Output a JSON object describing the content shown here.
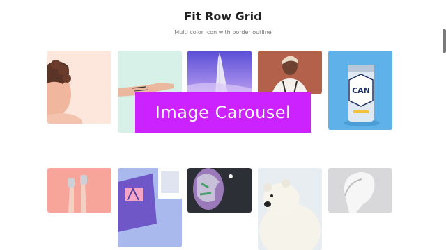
{
  "page": {
    "title": "Fit Row Grid",
    "subtitle": "Multi color icon with border outline"
  },
  "overlay": {
    "label": "Image Carousel",
    "color": "#cc22ff"
  },
  "grid": {
    "row1": [
      {
        "name": "curly-hair-child-photo",
        "bg": "#fde6dc"
      },
      {
        "name": "tattooed-hand-photo",
        "bg": "#d7f0e8"
      },
      {
        "name": "burj-al-arab-photo",
        "bg": "#6a5fd0"
      },
      {
        "name": "smiling-woman-photo",
        "bg": "#b3614a"
      },
      {
        "name": "can-mockup-photo",
        "bg": "#5fb1ea",
        "can_text": "CAN"
      }
    ],
    "row2": [
      {
        "name": "legs-in-air-photo",
        "bg": "#f7a49a"
      },
      {
        "name": "notebook-flatlay-photo",
        "bg": "#a9b9ee"
      },
      {
        "name": "painted-face-art-photo",
        "bg": "#2c2f36"
      },
      {
        "name": "polar-bear-photo",
        "bg": "#e8edf2"
      },
      {
        "name": "sculpted-head-photo",
        "bg": "#d8d8da"
      }
    ]
  }
}
